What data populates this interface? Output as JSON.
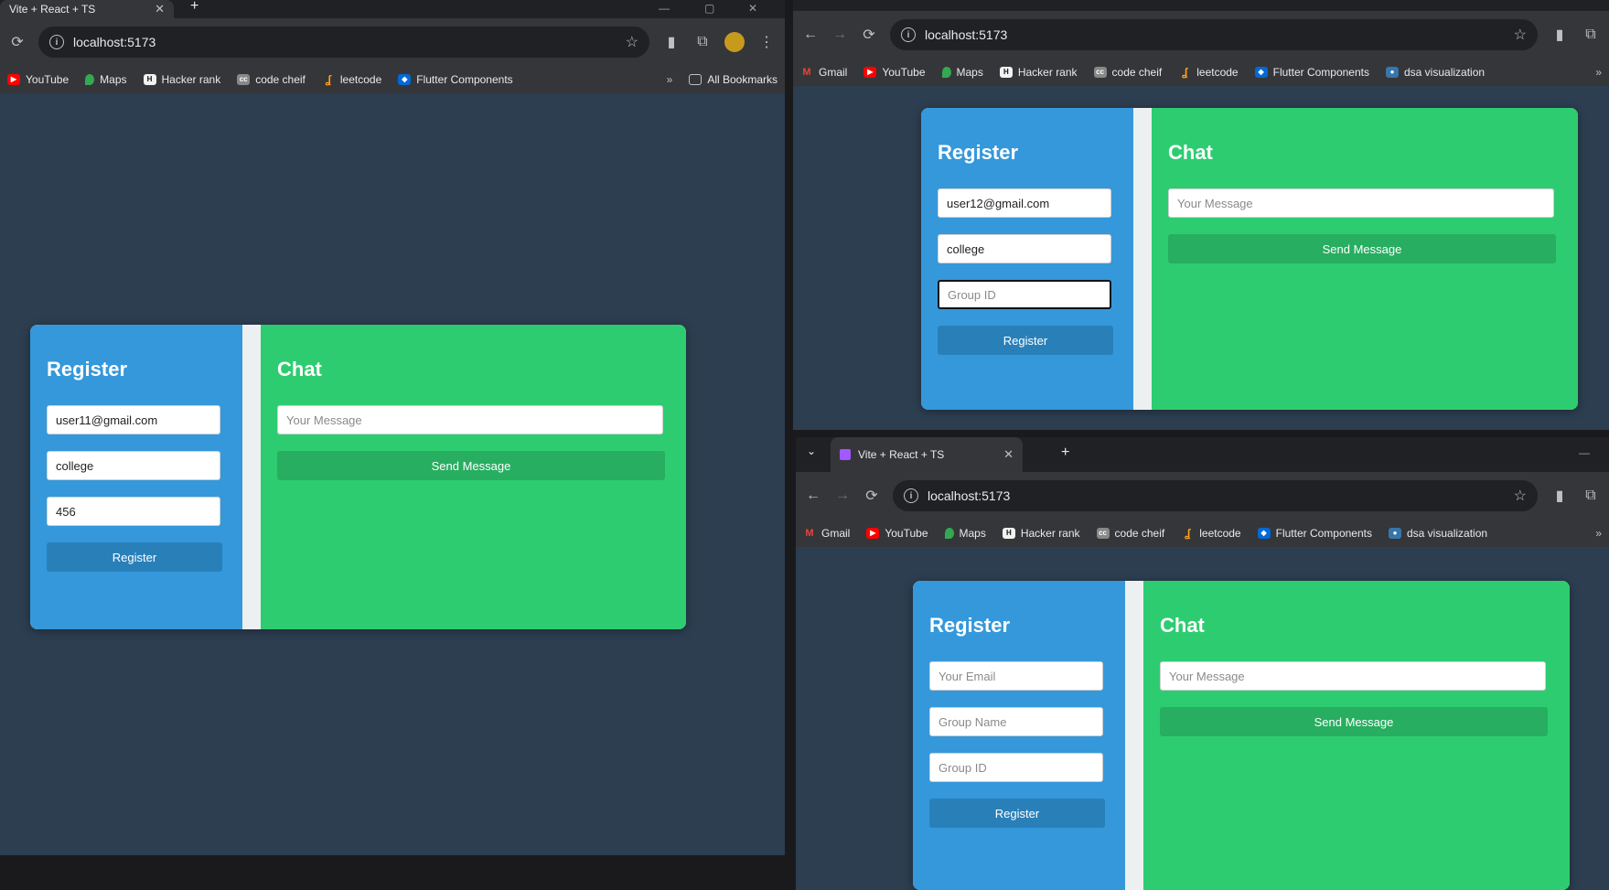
{
  "browser": {
    "tab_title": "Vite + React + TS",
    "url": "localhost:5173",
    "new_tab": "+",
    "close": "✕",
    "more": "»",
    "all_bookmarks": "All Bookmarks"
  },
  "bookmarks_left": [
    "YouTube",
    "Maps",
    "Hacker rank",
    "code cheif",
    "leetcode",
    "Flutter Components"
  ],
  "bookmarks_right": [
    "Gmail",
    "YouTube",
    "Maps",
    "Hacker rank",
    "code cheif",
    "leetcode",
    "Flutter Components",
    "dsa visualization"
  ],
  "bookmark_colors": {
    "youtube": "#ff0000",
    "gmail": "#ea4335",
    "maps": "#34a853",
    "hackerrank": "#1a1a1a",
    "codechef": "#5b4638",
    "leetcode": "#ffa116",
    "flutter": "#0468d7",
    "dsa": "#3776ab"
  },
  "app": {
    "register_title": "Register",
    "chat_title": "Chat",
    "email_placeholder": "Your Email",
    "group_name_placeholder": "Group Name",
    "group_id_placeholder": "Group ID",
    "message_placeholder": "Your Message",
    "register_button": "Register",
    "send_button": "Send Message"
  },
  "left_window": {
    "email": "user11@gmail.com",
    "group_name": "college",
    "group_id": "456"
  },
  "top_right_window": {
    "email": "user12@gmail.com",
    "group_name": "college",
    "group_id_placeholder": "Group ID"
  },
  "bottom_right_window": {}
}
